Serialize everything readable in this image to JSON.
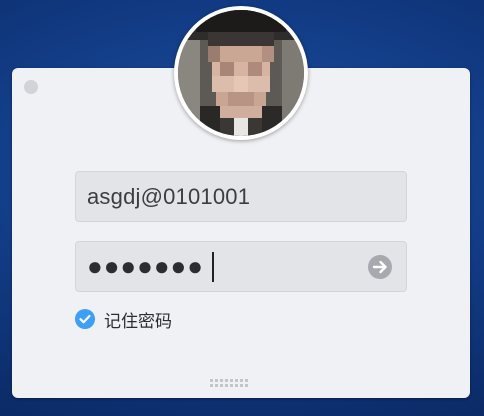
{
  "window": {
    "close_icon": "close-dot-icon"
  },
  "login": {
    "username_value": "asgdj@0101001",
    "password_masked": "●●●●●●●",
    "submit_icon": "arrow-right-icon",
    "remember_checked": true,
    "remember_label": "记住密码"
  },
  "colors": {
    "background": "#123c86",
    "panel": "#eff1f4",
    "field": "#e2e4e7",
    "accent": "#3d9ff5"
  }
}
